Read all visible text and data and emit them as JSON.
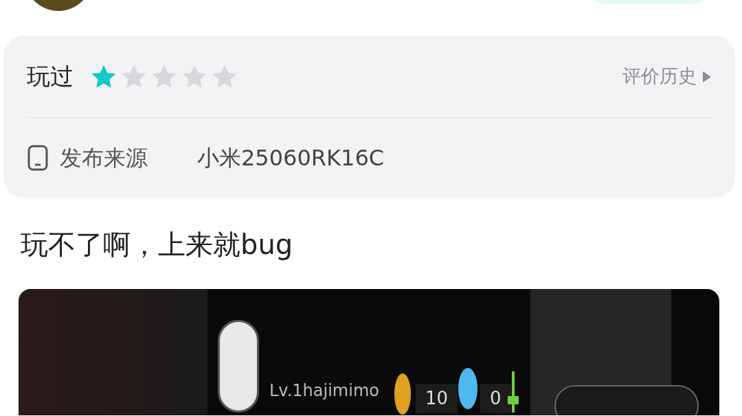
{
  "rating_card": {
    "status": "玩过",
    "stars": 1,
    "history_link": "评价历史",
    "source_label": "发布来源",
    "source_value": "小米25060RK16C"
  },
  "review_text": "玩不了啊，上来就bug",
  "attached_image": {
    "player_name": "Lv.1hajimimo",
    "coins": "10",
    "gems": "0"
  }
}
